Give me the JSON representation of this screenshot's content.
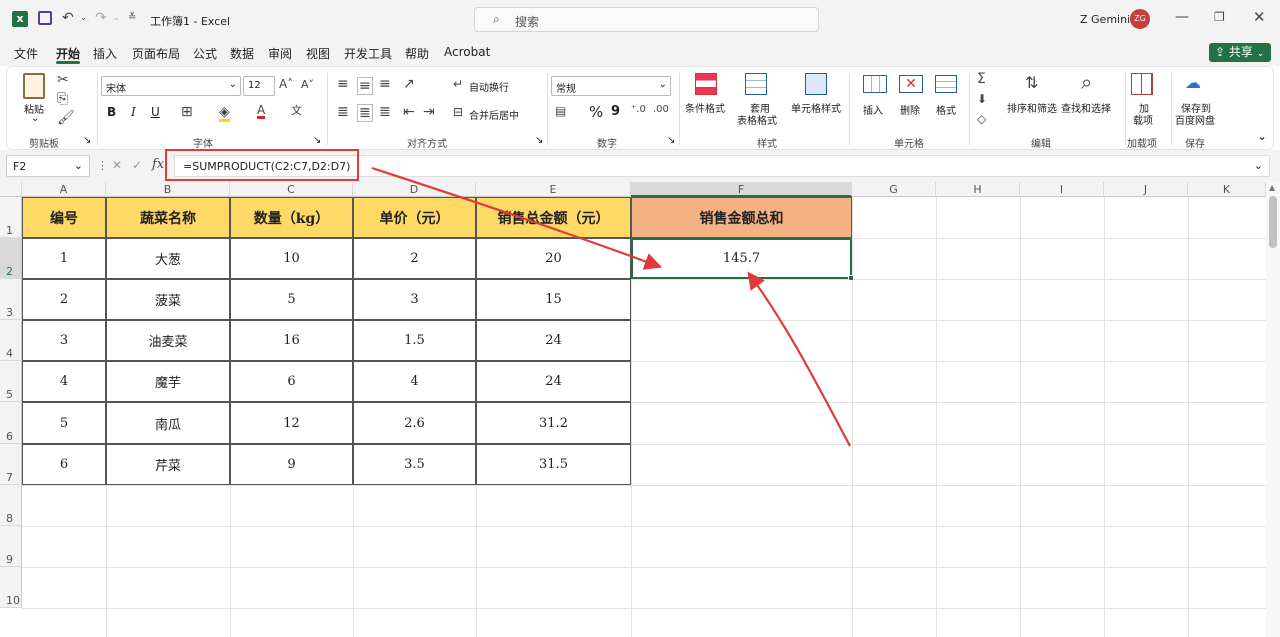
{
  "titlebar": {
    "doc_title": "工作簿1 - Excel",
    "search_placeholder": "搜索",
    "user_name": "Z Gemini",
    "user_initials": "ZG"
  },
  "menubar": {
    "tabs": [
      "文件",
      "开始",
      "插入",
      "页面布局",
      "公式",
      "数据",
      "审阅",
      "视图",
      "开发工具",
      "帮助",
      "Acrobat"
    ],
    "active_tab": "开始",
    "share_label": "共享"
  },
  "ribbon": {
    "clipboard": {
      "paste_label": "粘贴",
      "group_label": "剪贴板"
    },
    "font": {
      "font_name": "宋体",
      "font_size": "12",
      "bold": "B",
      "italic": "I",
      "underline": "U",
      "group_label": "字体"
    },
    "alignment": {
      "wrap_label": "自动换行",
      "merge_label": "合并后居中",
      "group_label": "对齐方式"
    },
    "number": {
      "format": "常规",
      "percent": "%",
      "comma": "9",
      "group_label": "数字"
    },
    "styles": {
      "cond_format": "条件格式",
      "table_format_1": "套用",
      "table_format_2": "表格格式",
      "cell_style": "单元格样式",
      "group_label": "样式"
    },
    "cells": {
      "insert": "插入",
      "delete": "删除",
      "format": "格式",
      "group_label": "单元格"
    },
    "editing": {
      "sort_filter": "排序和筛选",
      "find_select": "查找和选择",
      "group_label": "编辑"
    },
    "addins": {
      "label_1": "加",
      "label_2": "载项",
      "group_label": "加载项"
    },
    "save": {
      "label_1": "保存到",
      "label_2": "百度网盘",
      "group_label": "保存"
    }
  },
  "formulabar": {
    "name_box": "F2",
    "fx": "fx",
    "formula": "=SUMPRODUCT(C2:C7,D2:D7)"
  },
  "sheet": {
    "columns": [
      "A",
      "B",
      "C",
      "D",
      "E",
      "F",
      "G",
      "H",
      "I",
      "J",
      "K"
    ],
    "rows": [
      "1",
      "2",
      "3",
      "4",
      "5",
      "6",
      "7",
      "8",
      "9",
      "10"
    ],
    "table": {
      "headers": [
        "编号",
        "蔬菜名称",
        "数量（kg）",
        "单价（元）",
        "销售总金额（元）"
      ],
      "rows": [
        [
          "1",
          "大葱",
          "10",
          "2",
          "20"
        ],
        [
          "2",
          "菠菜",
          "5",
          "3",
          "15"
        ],
        [
          "3",
          "油麦菜",
          "16",
          "1.5",
          "24"
        ],
        [
          "4",
          "魔芋",
          "6",
          "4",
          "24"
        ],
        [
          "5",
          "南瓜",
          "12",
          "2.6",
          "31.2"
        ],
        [
          "6",
          "芹菜",
          "9",
          "3.5",
          "31.5"
        ]
      ]
    },
    "result_header": "销售金额总和",
    "result_value": "145.7"
  },
  "colors": {
    "header_fill": "#ffd966",
    "result_header_fill": "#f4b183",
    "excel_green": "#217346",
    "annotation_red": "#e03a3a"
  }
}
